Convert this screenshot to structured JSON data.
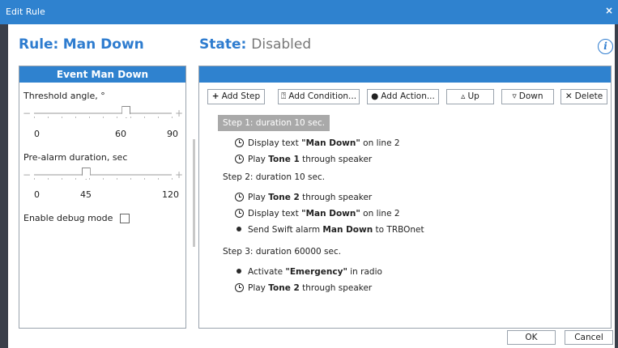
{
  "window": {
    "title": "Edit Rule",
    "close_glyph": "×"
  },
  "rule": {
    "label": "Rule:",
    "name": "Man Down"
  },
  "state": {
    "label": "State:",
    "value": "Disabled"
  },
  "info_glyph": "i",
  "left_panel": {
    "header": "Event  Man Down",
    "threshold": {
      "label": "Threshold angle, °",
      "min_label": "0",
      "mid_label": "60",
      "max_label": "90",
      "value": 60,
      "min": 0,
      "max": 90
    },
    "prealarm": {
      "label": "Pre-alarm duration, sec",
      "min_label": "0",
      "mid_label": "45",
      "max_label": "120",
      "value": 45,
      "min": 0,
      "max": 120
    },
    "debug": {
      "label": "Enable debug mode",
      "checked": false
    }
  },
  "toolbar": {
    "add_step": "Add Step",
    "add_condition": "Add Condition...",
    "add_action": "Add Action...",
    "up": "Up",
    "down": "Down",
    "delete": "Delete"
  },
  "steps": [
    {
      "header": "Step 1:  duration 10 sec.",
      "actions": [
        {
          "icon": "clock-icon",
          "pre": "Display text ",
          "bold": "\"Man Down\"",
          "post": " on line 2"
        },
        {
          "icon": "clock-icon",
          "pre": "Play ",
          "bold": "Tone 1",
          "post": " through speaker"
        }
      ]
    },
    {
      "header": "Step 2:  duration 10 sec.",
      "actions": [
        {
          "icon": "clock-icon",
          "pre": "Play ",
          "bold": "Tone 2",
          "post": " through speaker"
        },
        {
          "icon": "clock-icon",
          "pre": "Display text ",
          "bold": "\"Man Down\"",
          "post": " on line 2"
        },
        {
          "icon": "dot-icon",
          "pre": "Send Swift alarm ",
          "bold": "Man Down",
          "post": " to TRBOnet"
        }
      ]
    },
    {
      "header": "Step 3:  duration 60000 sec.",
      "actions": [
        {
          "icon": "dot-icon",
          "pre": "Activate ",
          "bold": "\"Emergency\"",
          "post": " in radio"
        },
        {
          "icon": "clock-icon",
          "pre": "Play ",
          "bold": "Tone 2",
          "post": " through speaker"
        }
      ]
    }
  ],
  "footer": {
    "ok": "OK",
    "cancel": "Cancel"
  }
}
